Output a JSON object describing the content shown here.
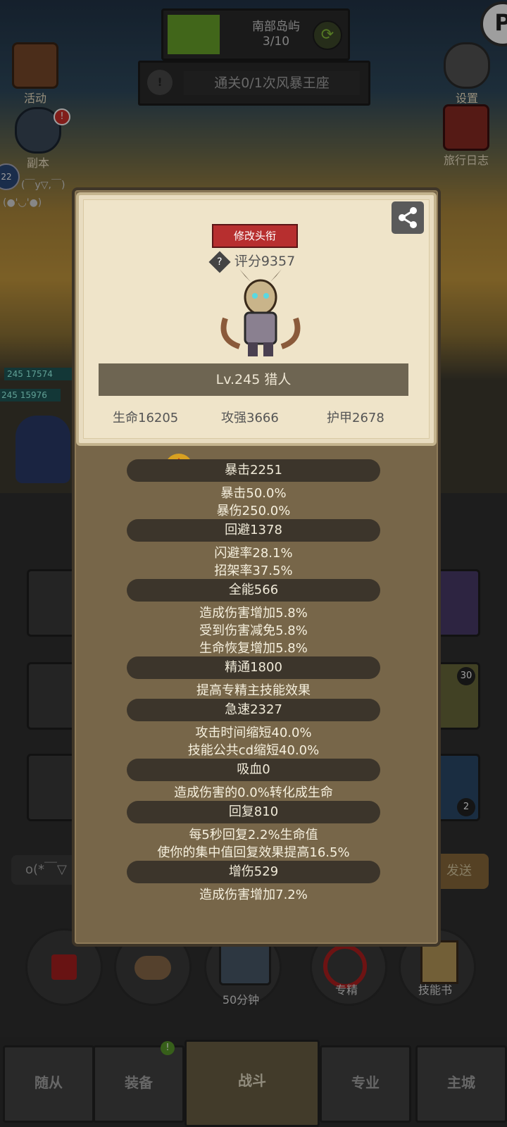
{
  "hud": {
    "zone_title": "南部岛屿",
    "zone_progress": "3/10",
    "progress_fraction": 0.3,
    "quest_text": "通关0/1次风暴王座",
    "left_buttons": [
      "活动",
      "副本"
    ],
    "right_buttons": [
      "设置",
      "旅行日志"
    ],
    "dungeon_badge": "!",
    "level_badge": "22",
    "emote1": "(￣y▽,￣)",
    "emote2": "(●'◡'●)",
    "unit_hp": [
      {
        "level": "245",
        "value": "17574"
      },
      {
        "level": "245",
        "value": "15976"
      }
    ]
  },
  "profile": {
    "title_button": "修改头衔",
    "score_label": "评分9357",
    "level_class": "Lv.245 猎人",
    "stats": [
      {
        "label": "生命16205"
      },
      {
        "label": "攻强3666"
      },
      {
        "label": "护甲2678"
      }
    ],
    "sections": [
      {
        "header": "暴击2251",
        "lines": [
          "暴击50.0%",
          "暴伤250.0%"
        ]
      },
      {
        "header": "回避1378",
        "lines": [
          "闪避率28.1%",
          "招架率37.5%"
        ]
      },
      {
        "header": "全能566",
        "lines": [
          "造成伤害增加5.8%",
          "受到伤害减免5.8%",
          "生命恢复增加5.8%"
        ]
      },
      {
        "header": "精通1800",
        "lines": [
          "提高专精主技能效果"
        ]
      },
      {
        "header": "急速2327",
        "lines": [
          "攻击时间缩短40.0%",
          "技能公共cd缩短40.0%"
        ]
      },
      {
        "header": "吸血0",
        "lines": [
          "造成伤害的0.0%转化成生命"
        ]
      },
      {
        "header": "回复810",
        "lines": [
          "每5秒回复2.2%生命值",
          "使你的集中值回复效果提高16.5%"
        ]
      },
      {
        "header": "增伤529",
        "lines": [
          "造成伤害增加7.2%"
        ]
      }
    ]
  },
  "background": {
    "chat_placeholder": "o(*￣▽",
    "send_button": "发送",
    "slot_counts": [
      "30",
      "2"
    ],
    "actions": [
      {
        "label": ""
      },
      {
        "label": ""
      },
      {
        "label": "50分钟"
      },
      {
        "label": "专精"
      },
      {
        "label": "技能书"
      }
    ]
  },
  "nav": {
    "tabs": [
      "随从",
      "装备",
      "战斗",
      "专业",
      "主城"
    ],
    "active": "战斗"
  },
  "colors": {
    "panel": "#776649",
    "card": "#efe4c9",
    "title_button": "#b72f2f",
    "pill": "#3c352b",
    "progress_green": "#6aa52a"
  }
}
